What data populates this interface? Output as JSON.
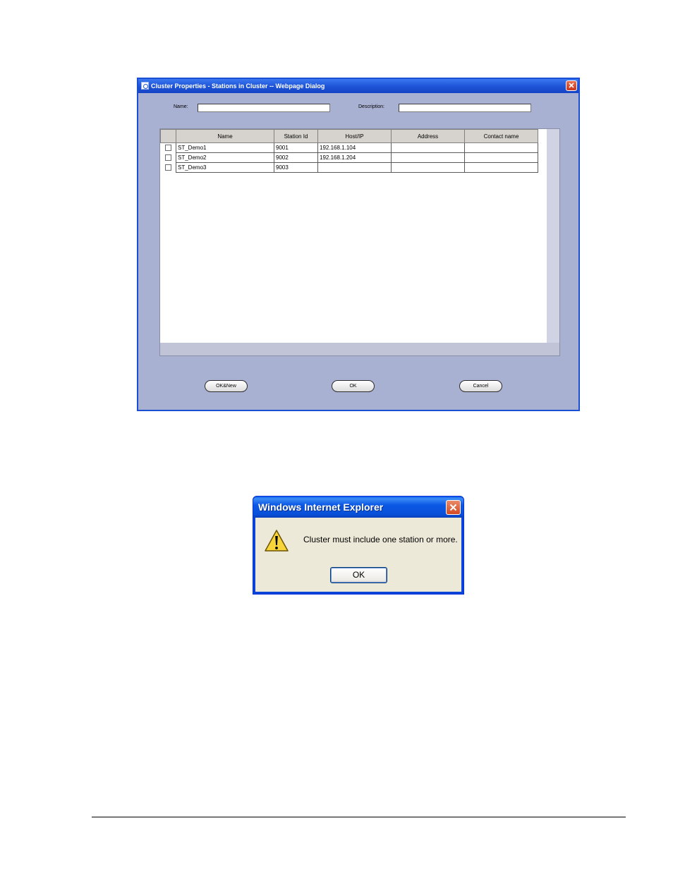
{
  "cluster_dialog": {
    "title": "Cluster Properties - Stations in Cluster -- Webpage Dialog",
    "name_label": "Name:",
    "name_value": "",
    "description_label": "Description:",
    "description_value": "",
    "columns": [
      "Name",
      "Station Id",
      "Host/IP",
      "Address",
      "Contact name"
    ],
    "rows": [
      {
        "name": "ST_Demo1",
        "station_id": "9001",
        "host": "192.168.1.104",
        "address": "",
        "contact": ""
      },
      {
        "name": "ST_Demo2",
        "station_id": "9002",
        "host": "192.168.1.204",
        "address": "",
        "contact": ""
      },
      {
        "name": "ST_Demo3",
        "station_id": "9003",
        "host": "",
        "address": "",
        "contact": ""
      }
    ],
    "buttons": {
      "ok_new": "OK&New",
      "ok": "OK",
      "cancel": "Cancel"
    },
    "colors": {
      "background": "#a9b1d3",
      "titlebar": "#1f55d8"
    }
  },
  "alert_dialog": {
    "title": "Windows Internet Explorer",
    "message": "Cluster must include one station or more.",
    "ok_label": "OK",
    "icon": "warning-icon"
  }
}
